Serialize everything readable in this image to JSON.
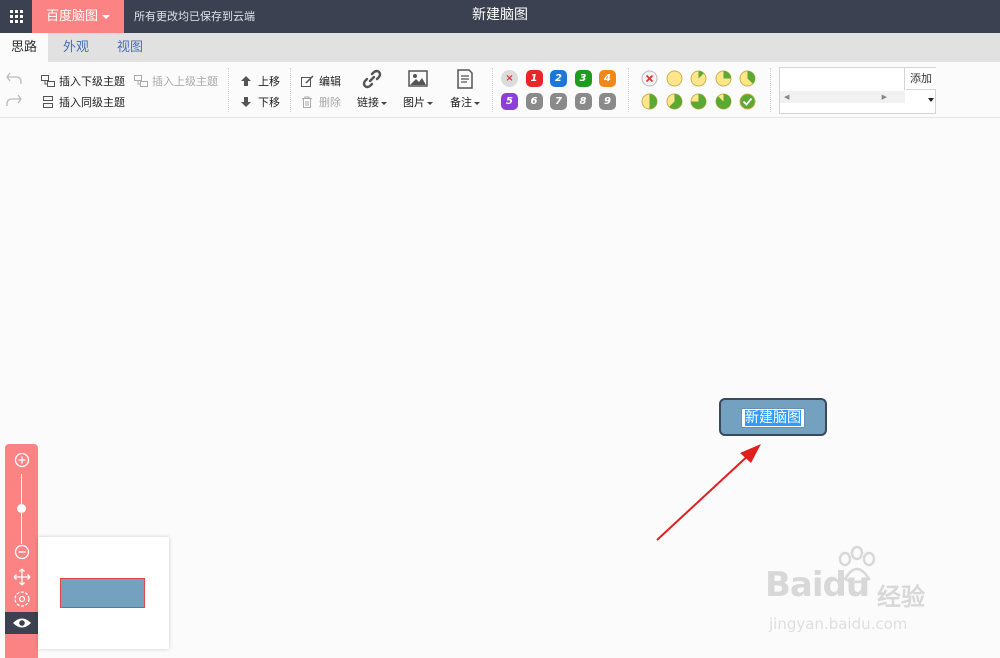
{
  "topbar": {
    "brand": "百度脑图",
    "save_status": "所有更改均已保存到云端",
    "title": "新建脑图"
  },
  "tabs": [
    {
      "label": "思路",
      "active": true
    },
    {
      "label": "外观",
      "active": false
    },
    {
      "label": "视图",
      "active": false
    }
  ],
  "toolbar": {
    "insert_child": "插入下级主题",
    "insert_parent": "插入上级主题",
    "insert_sibling": "插入同级主题",
    "move_up": "上移",
    "move_down": "下移",
    "edit": "编辑",
    "delete": "删除",
    "link": "链接",
    "image": "图片",
    "note": "备注",
    "priority_icons": [
      {
        "label": "×",
        "color": "#dcdcdc",
        "text_color": "#d33"
      },
      {
        "label": "1",
        "color": "#e8262a"
      },
      {
        "label": "2",
        "color": "#1b78d8"
      },
      {
        "label": "3",
        "color": "#1f9c1f"
      },
      {
        "label": "4",
        "color": "#f2881b"
      },
      {
        "label": "5",
        "color": "#8a40d6"
      },
      {
        "label": "6",
        "color": "#8a8a8a"
      },
      {
        "label": "7",
        "color": "#8a8a8a"
      },
      {
        "label": "8",
        "color": "#8a8a8a"
      },
      {
        "label": "9",
        "color": "#8a8a8a"
      }
    ],
    "progress_levels": [
      0,
      0,
      0.125,
      0.25,
      0.375,
      0.5,
      0.625,
      0.75,
      0.875,
      1
    ],
    "resource_add": "添加",
    "resource_input_value": ""
  },
  "canvas": {
    "root_topic": "新建脑图"
  },
  "colors": {
    "topbar": "#3b4150",
    "brand": "#fc8383",
    "node_fill": "#73a1bf",
    "node_border": "#3b4a5a",
    "arrow": "#e02020"
  },
  "watermark": {
    "main": "Bai",
    "du": "du",
    "cn": "经验",
    "sub": "jingyan.baidu.com"
  }
}
